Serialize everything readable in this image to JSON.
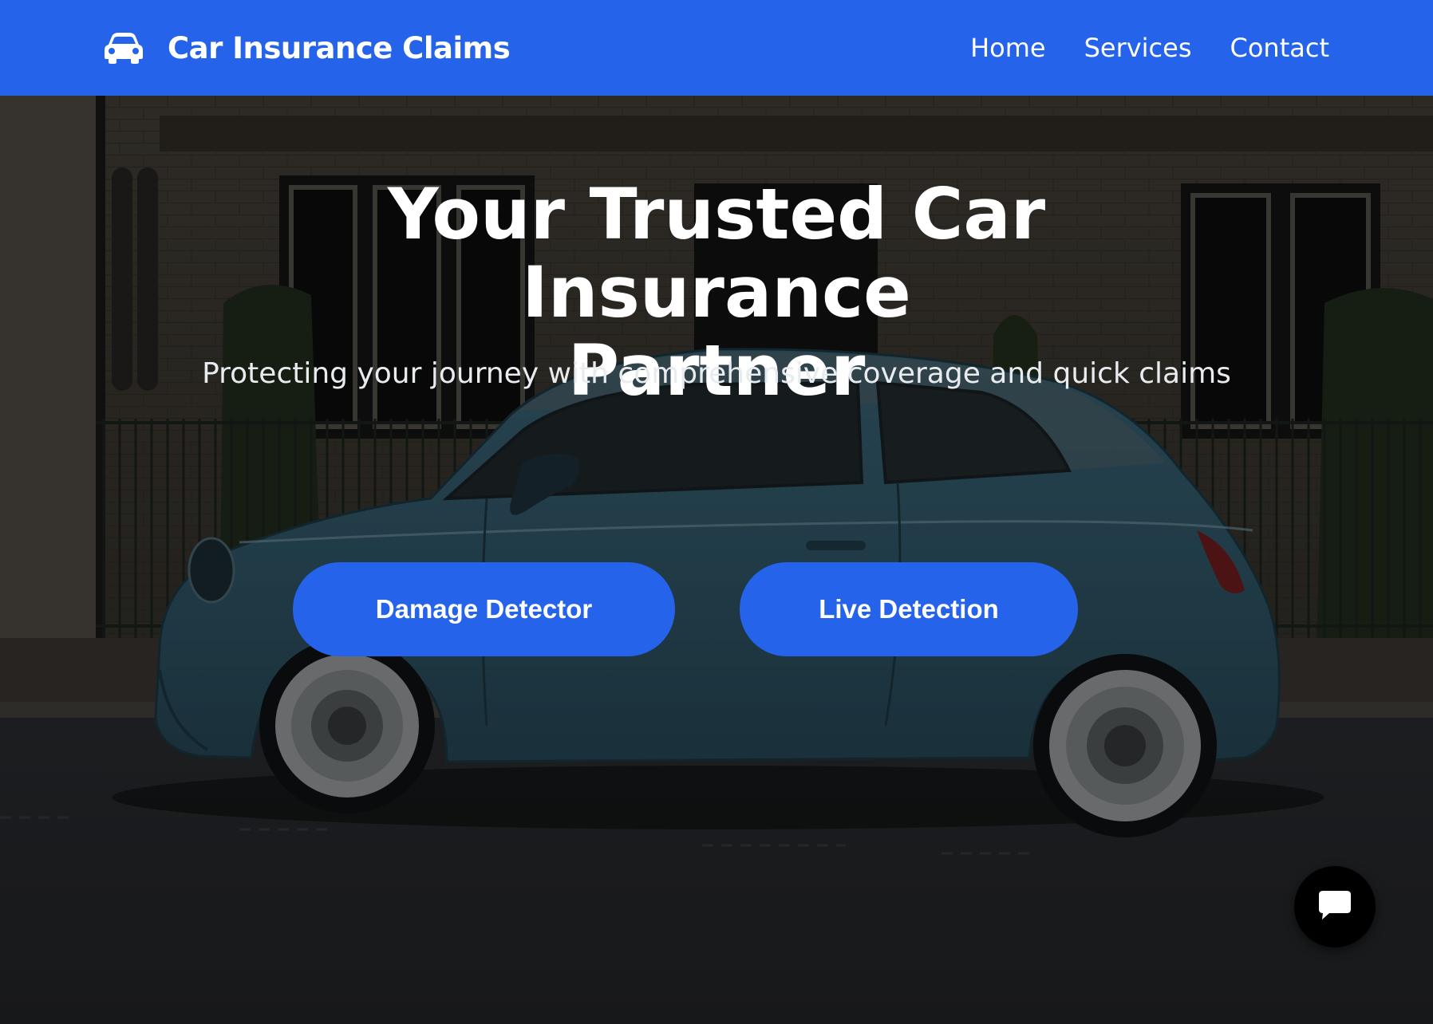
{
  "navbar": {
    "brand": {
      "icon": "car-icon",
      "name": "Car Insurance Claims"
    },
    "links": [
      {
        "label": "Home"
      },
      {
        "label": "Services"
      },
      {
        "label": "Contact"
      }
    ],
    "background_color": "#2563eb"
  },
  "hero": {
    "title_line1": "Your Trusted Car Insurance",
    "title_line2": "Partner",
    "subtitle": "Protecting your journey with comprehensive coverage and quick claims",
    "buttons": [
      {
        "label": "Damage Detector"
      },
      {
        "label": "Live Detection"
      }
    ],
    "button_color": "#2563eb"
  },
  "chat": {
    "icon": "chat-bubble-icon"
  }
}
